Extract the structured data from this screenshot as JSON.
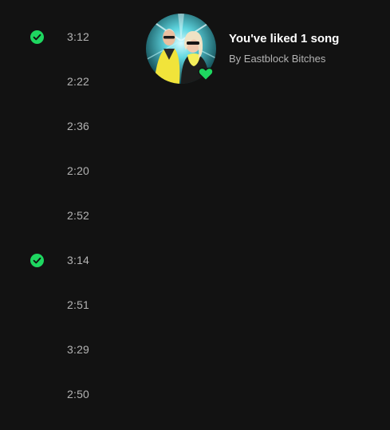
{
  "tracks": [
    {
      "duration": "3:12",
      "liked": true
    },
    {
      "duration": "2:22",
      "liked": false
    },
    {
      "duration": "2:36",
      "liked": false
    },
    {
      "duration": "2:20",
      "liked": false
    },
    {
      "duration": "2:52",
      "liked": false
    },
    {
      "duration": "3:14",
      "liked": true
    },
    {
      "duration": "2:51",
      "liked": false
    },
    {
      "duration": "3:29",
      "liked": false
    },
    {
      "duration": "2:50",
      "liked": false
    }
  ],
  "liked_songs": {
    "title": "You've liked 1 song",
    "subtitle": "By Eastblock Bitches",
    "artwork_icon": "artist-photo",
    "badge_icon": "heart-icon"
  },
  "colors": {
    "background": "#121212",
    "accent": "#1ed760",
    "text_primary": "#ffffff",
    "text_secondary": "#b3b3b3"
  }
}
